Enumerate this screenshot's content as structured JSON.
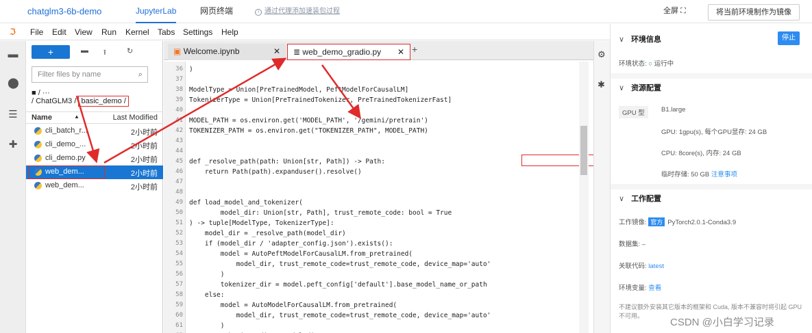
{
  "topbar": {
    "project": "chatglm3-6b-demo",
    "tabs": [
      "JupyterLab",
      "网页终端"
    ],
    "hint": "通过代理添加速装包过程",
    "fullscreen": "全屏",
    "make_image_button": "将当前环境制作为镜像"
  },
  "menu": [
    "File",
    "Edit",
    "View",
    "Run",
    "Kernel",
    "Tabs",
    "Settings",
    "Help"
  ],
  "filebrowser": {
    "new_button": "+",
    "filter_placeholder": "Filter files by name",
    "breadcrumb_top": "■ / ···",
    "breadcrumb_prefix": "/ ChatGLM3 /",
    "breadcrumb_highlight": "basic_demo /",
    "col_name": "Name",
    "col_modified": "Last Modified",
    "files": [
      {
        "name": "cli_batch_r...",
        "modified": "2小时前"
      },
      {
        "name": "cli_demo_...",
        "modified": "2小时前"
      },
      {
        "name": "cli_demo.py",
        "modified": "2小时前"
      },
      {
        "name": "web_dem...",
        "modified": "2小时前"
      },
      {
        "name": "web_dem...",
        "modified": "2小时前"
      }
    ]
  },
  "editor": {
    "tabs": [
      {
        "label": "Welcome.ipynb"
      },
      {
        "label": "web_demo_gradio.py"
      }
    ],
    "line_numbers": [
      "36",
      "37",
      "38",
      "39",
      "40",
      "41",
      "42",
      "43",
      "44",
      "45",
      "46",
      "47",
      "48",
      "49",
      "50",
      "51",
      "52",
      "53",
      "54",
      "55",
      "56",
      "57",
      "58",
      "59",
      "60",
      "61",
      "62"
    ],
    "lines": [
      ")",
      "",
      "ModelType = Union[PreTrainedModel, PeftModelForCausalLM]",
      "TokenizerType = Union[PreTrainedTokenizer, PreTrainedTokenizerFast]",
      "",
      "MODEL_PATH = os.environ.get('MODEL_PATH', '/gemini/pretrain')",
      "TOKENIZER_PATH = os.environ.get(\"TOKENIZER_PATH\", MODEL_PATH)",
      "",
      "",
      "def _resolve_path(path: Union[str, Path]) -> Path:",
      "    return Path(path).expanduser().resolve()",
      "",
      "",
      "def load_model_and_tokenizer(",
      "        model_dir: Union[str, Path], trust_remote_code: bool = True",
      ") -> tuple[ModelType, TokenizerType]:",
      "    model_dir = _resolve_path(model_dir)",
      "    if (model_dir / 'adapter_config.json').exists():",
      "        model = AutoPeftModelForCausalLM.from_pretrained(",
      "            model_dir, trust_remote_code=trust_remote_code, device_map='auto'",
      "        )",
      "        tokenizer_dir = model.peft_config['default'].base_model_name_or_path",
      "    else:",
      "        model = AutoModelForCausalLM.from_pretrained(",
      "            model_dir, trust_remote_code=trust_remote_code, device_map='auto'",
      "        )",
      "        tokenizer_dir = model_dir"
    ]
  },
  "right_panel": {
    "env_title": "环境信息",
    "stop_button": "停止",
    "env_status_label": "环境状态:",
    "env_status_value": "运行中",
    "res_title": "资源配置",
    "gpu_type_label": "GPU 型",
    "gpu_type_value": "B1.large",
    "gpu_line": "GPU: 1gpu(s), 每个GPU显存: 24 GB",
    "cpu_line": "CPU: 8core(s), 内存: 24 GB",
    "storage_line": "临时存储: 50 GB",
    "storage_link": "注意事项",
    "work_title": "工作配置",
    "image_label": "工作镜像:",
    "image_badge": "官方",
    "image_value": "PyTorch2.0.1-Conda3.9",
    "dataset_label": "数据集:",
    "dataset_value": "–",
    "code_label": "关联代码:",
    "code_value": "latest",
    "envvar_label": "环境变量:",
    "envvar_value": "查看",
    "note": "不建议额外安装其它版本的框架和 Cuda, 版本不兼容时将引起 GPU 不可用。"
  },
  "watermark": "CSDN @小白学习记录",
  "colors": {
    "accent": "#1976d2",
    "highlight": "#e02b2b",
    "jupyter_orange": "#f37626"
  }
}
